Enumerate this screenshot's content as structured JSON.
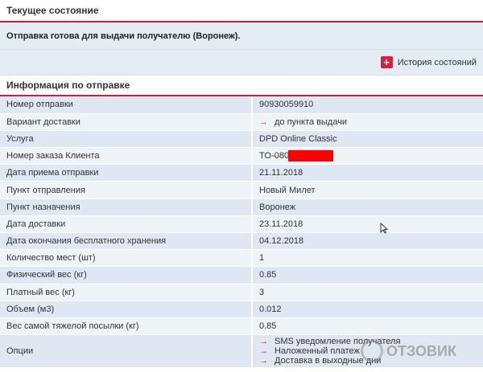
{
  "current_state": {
    "heading": "Текущее состояние",
    "status": "Отправка готова для выдачи получателю (Воронеж).",
    "history_link": "История состояний"
  },
  "shipment_info": {
    "heading": "Информация по отправке",
    "rows": [
      {
        "label": "Номер отправки",
        "value": "90930059910"
      },
      {
        "label": "Вариант доставки",
        "value": "до пункта выдачи"
      },
      {
        "label": "Услуга",
        "value": "DPD Online Classic"
      },
      {
        "label": "Номер заказа Клиента",
        "value": "TO-080"
      },
      {
        "label": "Дата приема отправки",
        "value": "21.11.2018"
      },
      {
        "label": "Пункт отправления",
        "value": "Новый Милет"
      },
      {
        "label": "Пункт назначения",
        "value": "Воронеж"
      },
      {
        "label": "Дата доставки",
        "value": "23.11.2018"
      },
      {
        "label": "Дата окончания бесплатного хранения",
        "value": "04.12.2018"
      },
      {
        "label": "Количество мест (шт)",
        "value": "1"
      },
      {
        "label": "Физический вес (кг)",
        "value": "0.85"
      },
      {
        "label": "Платный вес (кг)",
        "value": "3"
      },
      {
        "label": "Объем (м3)",
        "value": "0.012"
      },
      {
        "label": "Вес самой тяжелой посылки (кг)",
        "value": "0.85"
      },
      {
        "label": "Опции",
        "options": [
          "SMS уведомление получателя",
          "Наложенный платеж",
          "Доставка в выходные дни"
        ]
      }
    ]
  },
  "arrow_glyph": "→",
  "watermark": "ОТЗОВИК",
  "accent_color": "#c8203c"
}
